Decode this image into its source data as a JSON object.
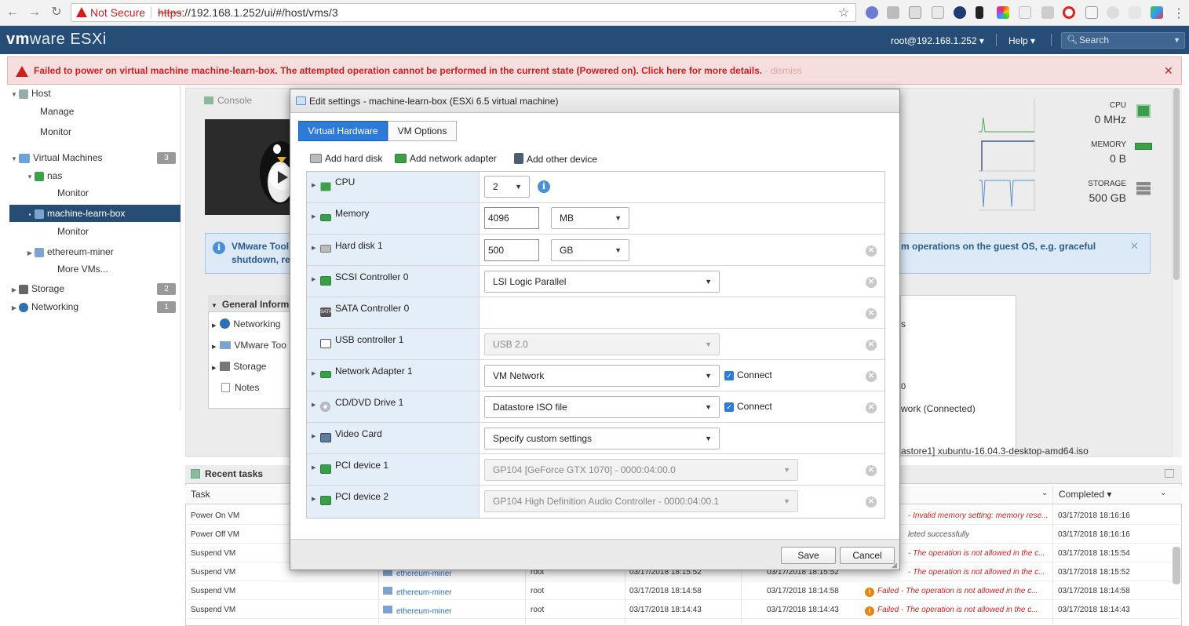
{
  "browser": {
    "not_secure": "Not Secure",
    "url_scheme": "https",
    "url_rest": "://192.168.1.252/ui/#/host/vms/3"
  },
  "header": {
    "logo_vm": "vm",
    "logo_ware": "ware",
    "logo_esxi": "ESXi",
    "user": "root@192.168.1.252 ▾",
    "help": "Help ▾",
    "search_placeholder": "Search"
  },
  "error": {
    "message": "Failed to power on virtual machine machine-learn-box. The attempted operation cannot be performed in the current state (Powered on). Click here for more details.",
    "dismiss": " - dismiss"
  },
  "navigator": {
    "host": "Host",
    "manage": "Manage",
    "monitor": "Monitor",
    "vms": "Virtual Machines",
    "vms_count": "3",
    "nas": "nas",
    "nas_monitor": "Monitor",
    "mlb": "machine-learn-box",
    "mlb_monitor": "Monitor",
    "eth": "ethereum-miner",
    "more": "More VMs...",
    "storage": "Storage",
    "storage_count": "2",
    "networking": "Networking",
    "networking_count": "1"
  },
  "background": {
    "console": "Console",
    "info_line1": "VMware Tool",
    "info_line2": "shutdown, re",
    "info_line3": "m operations on the guest OS, e.g. graceful",
    "general_info": "General Inform",
    "gen_networking": "Networking",
    "gen_vmtools": "VMware Too",
    "gen_storage": "Storage",
    "gen_notes": "Notes",
    "frag1": "s",
    "frag2": "work (Connected)",
    "frag3": "astore1] xubuntu-16.04.3-desktop-amd64.iso",
    "cpu_label": "CPU",
    "cpu_value": "0 MHz",
    "mem_label": "MEMORY",
    "mem_value": "0 B",
    "stor_label": "STORAGE",
    "stor_value": "500 GB"
  },
  "tasks": {
    "title": "Recent tasks",
    "col_task": "Task",
    "col_completed": "Completed ▾",
    "rows": [
      {
        "task": "Power On VM",
        "target": "",
        "initiator": "",
        "queued": "",
        "started": "",
        "result": "- Invalid memory setting: memory rese...",
        "completed": "03/17/2018 18:16:16"
      },
      {
        "task": "Power Off VM",
        "target": "",
        "initiator": "",
        "queued": "",
        "started": "",
        "result": "leted successfully",
        "completed": "03/17/2018 18:16:16"
      },
      {
        "task": "Suspend VM",
        "target": "",
        "initiator": "",
        "queued": "",
        "started": "",
        "result": "- The operation is not allowed in the c...",
        "completed": "03/17/2018 18:15:54"
      },
      {
        "task": "Suspend VM",
        "target": "ethereum-miner",
        "initiator": "root",
        "queued": "03/17/2018 18:15:52",
        "started": "03/17/2018 18:15:52",
        "result": "- The operation is not allowed in the c...",
        "completed": "03/17/2018 18:15:52"
      },
      {
        "task": "Suspend VM",
        "target": "ethereum-miner",
        "initiator": "root",
        "queued": "03/17/2018 18:14:58",
        "started": "03/17/2018 18:14:58",
        "result": "Failed - The operation is not allowed in the c...",
        "completed": "03/17/2018 18:14:58"
      },
      {
        "task": "Suspend VM",
        "target": "ethereum-miner",
        "initiator": "root",
        "queued": "03/17/2018 18:14:43",
        "started": "03/17/2018 18:14:43",
        "result": "Failed - The operation is not allowed in the c...",
        "completed": "03/17/2018 18:14:43"
      }
    ]
  },
  "dialog": {
    "title": "Edit settings - machine-learn-box (ESXi 6.5 virtual machine)",
    "tab_hardware": "Virtual Hardware",
    "tab_options": "VM Options",
    "add_disk": "Add hard disk",
    "add_net": "Add network adapter",
    "add_other": "Add other device",
    "save": "Save",
    "cancel": "Cancel",
    "hw": {
      "cpu": {
        "label": "CPU",
        "value": "2"
      },
      "memory": {
        "label": "Memory",
        "value": "4096",
        "unit": "MB"
      },
      "disk": {
        "label": "Hard disk 1",
        "value": "500",
        "unit": "GB"
      },
      "scsi": {
        "label": "SCSI Controller 0",
        "value": "LSI Logic Parallel"
      },
      "sata": {
        "label": "SATA Controller 0"
      },
      "usb": {
        "label": "USB controller 1",
        "value": "USB 2.0"
      },
      "net": {
        "label": "Network Adapter 1",
        "value": "VM Network",
        "connect": "Connect"
      },
      "cd": {
        "label": "CD/DVD Drive 1",
        "value": "Datastore ISO file",
        "connect": "Connect"
      },
      "video": {
        "label": "Video Card",
        "value": "Specify custom settings"
      },
      "pci1": {
        "label": "PCI device 1",
        "value": "GP104 [GeForce GTX 1070] - 0000:04:00.0"
      },
      "pci2": {
        "label": "PCI device 2",
        "value": "GP104 High Definition Audio Controller - 0000:04:00.1"
      }
    }
  }
}
